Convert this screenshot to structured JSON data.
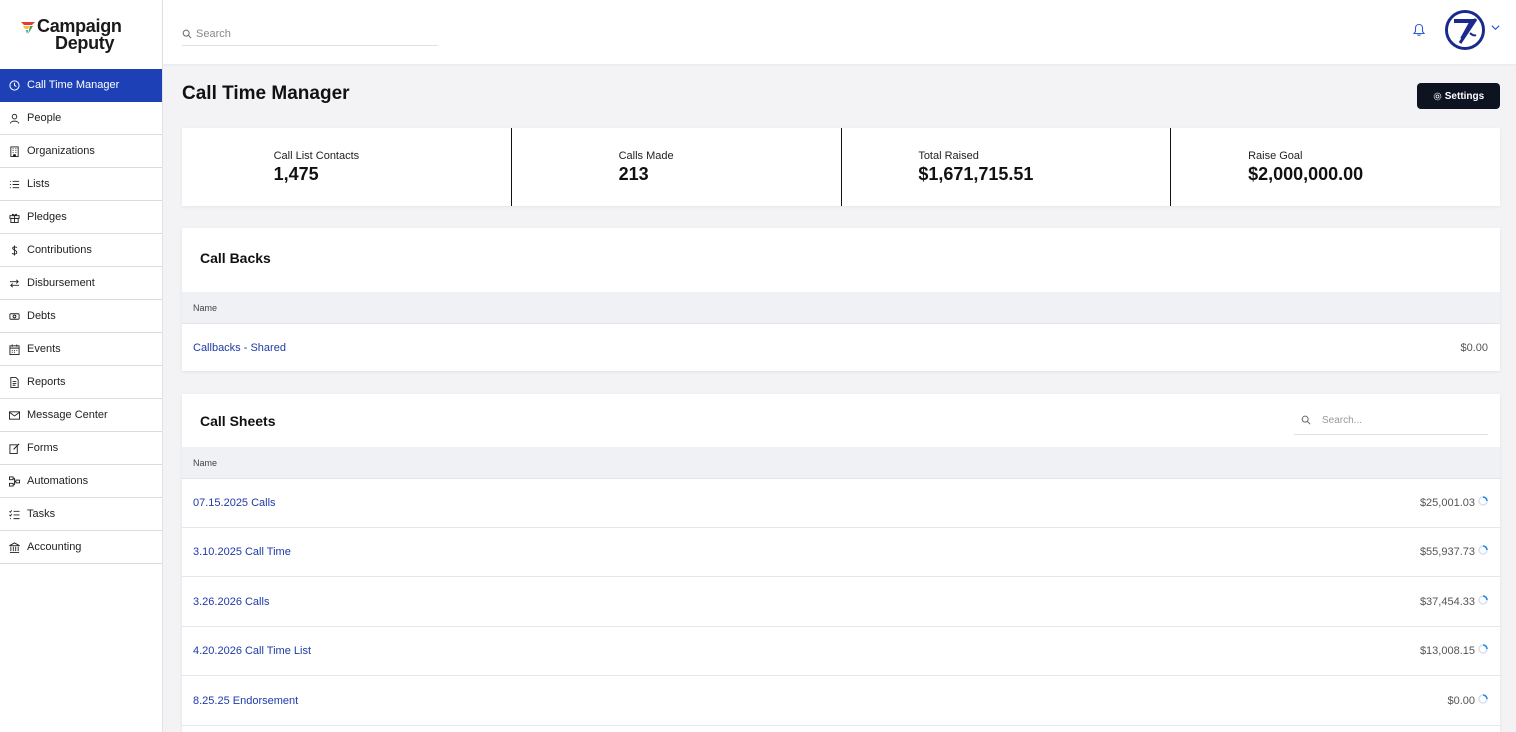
{
  "brand": {
    "line1": "Campaign",
    "line2": "Deputy"
  },
  "search": {
    "placeholder": "Search"
  },
  "sidebar": {
    "items": [
      {
        "label": "Call Time Manager",
        "icon": "clock-icon",
        "active": true
      },
      {
        "label": "People",
        "icon": "person-icon"
      },
      {
        "label": "Organizations",
        "icon": "building-icon"
      },
      {
        "label": "Lists",
        "icon": "list-icon"
      },
      {
        "label": "Pledges",
        "icon": "gift-icon"
      },
      {
        "label": "Contributions",
        "icon": "dollar-icon"
      },
      {
        "label": "Disbursement",
        "icon": "transfer-icon"
      },
      {
        "label": "Debts",
        "icon": "money-icon"
      },
      {
        "label": "Events",
        "icon": "calendar-icon"
      },
      {
        "label": "Reports",
        "icon": "report-icon"
      },
      {
        "label": "Message Center",
        "icon": "mail-icon"
      },
      {
        "label": "Forms",
        "icon": "form-icon"
      },
      {
        "label": "Automations",
        "icon": "automation-icon"
      },
      {
        "label": "Tasks",
        "icon": "tasks-icon"
      },
      {
        "label": "Accounting",
        "icon": "bank-icon"
      }
    ]
  },
  "header": {
    "title": "Call Time Manager",
    "settings_label": "Settings"
  },
  "stats": [
    {
      "label": "Call List Contacts",
      "value": "1,475"
    },
    {
      "label": "Calls Made",
      "value": "213"
    },
    {
      "label": "Total Raised",
      "value": "$1,671,715.51"
    },
    {
      "label": "Raise Goal",
      "value": "$2,000,000.00"
    }
  ],
  "callbacks": {
    "title": "Call Backs",
    "column": "Name",
    "rows": [
      {
        "name": "Callbacks - Shared",
        "amount": "$0.00"
      }
    ]
  },
  "callsheets": {
    "title": "Call Sheets",
    "search_placeholder": "Search...",
    "column": "Name",
    "rows": [
      {
        "name": "07.15.2025 Calls",
        "amount": "$25,001.03"
      },
      {
        "name": "3.10.2025 Call Time",
        "amount": "$55,937.73"
      },
      {
        "name": "3.26.2026 Calls",
        "amount": "$37,454.33"
      },
      {
        "name": "4.20.2026 Call Time List",
        "amount": "$13,008.15"
      },
      {
        "name": "8.25.25 Endorsement",
        "amount": "$0.00"
      }
    ]
  },
  "colors": {
    "accent": "#1e40b6",
    "link": "#1e3aa8",
    "dark_button": "#0d1320"
  }
}
